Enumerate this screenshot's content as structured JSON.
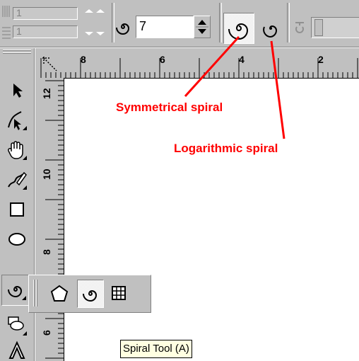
{
  "property_bar": {
    "disabled_field_1": "1",
    "disabled_field_2": "1",
    "revolutions_value": "7",
    "spiral_modes": [
      {
        "name": "symmetrical",
        "selected": true
      },
      {
        "name": "logarithmic",
        "selected": false
      }
    ]
  },
  "ruler": {
    "top_labels": [
      "8",
      "6",
      "4",
      "2"
    ],
    "left_labels": [
      "12",
      "10",
      "8",
      "6"
    ]
  },
  "toolbox": {
    "tools": [
      "pick-tool-icon",
      "shape-tool-icon",
      "zoom-tool-icon",
      "freehand-tool-icon",
      "rectangle-tool-icon",
      "ellipse-tool-icon",
      "spiral-tool-icon",
      "polygon-group-icon",
      "text-tool-icon"
    ],
    "flyout_tools": [
      "polygon-icon",
      "spiral-icon",
      "graph-paper-icon"
    ],
    "flyout_selected": "spiral-icon"
  },
  "tooltip": "Spiral Tool (A)",
  "annotations": {
    "symmetrical": "Symmetrical spiral",
    "logarithmic": "Logarithmic spiral"
  },
  "colors": {
    "annotation": "#ff0000",
    "face": "#c0c0c0"
  }
}
